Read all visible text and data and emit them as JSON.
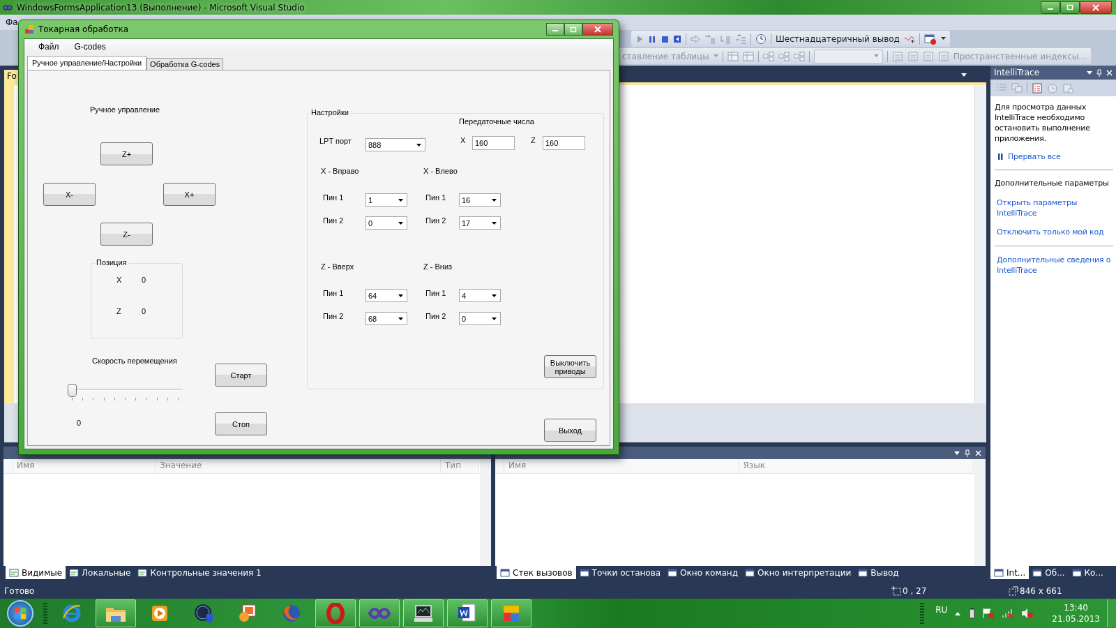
{
  "vs": {
    "title": "WindowsFormsApplication13 (Выполнение) - Microsoft Visual Studio",
    "menu": [
      "Фа"
    ],
    "toolbar1": {
      "label": "Шестнадцатеричный вывод"
    },
    "toolbar2": {
      "menu_label": "ставление таблицы",
      "label": "Пространственные индексы..."
    },
    "doc_tab": "Fo",
    "intellitrace": {
      "title": "IntelliTrace",
      "message": "Для просмотра данных IntelliTrace необходимо остановить выполнение приложения.",
      "break_link": "Прервать все",
      "section": "Дополнительные параметры",
      "links": [
        "Открыть параметры IntelliTrace",
        "Отключить только мой код"
      ],
      "more_link": "Дополнительные сведения о IntelliTrace"
    },
    "left_panel": {
      "columns": [
        "Имя",
        "Значение",
        "Тип"
      ]
    },
    "right_panel": {
      "columns": [
        "Имя",
        "Язык"
      ]
    },
    "left_tabs": [
      {
        "label": "Видимые",
        "selected": true
      },
      {
        "label": "Локальные",
        "selected": false
      },
      {
        "label": "Контрольные значения 1",
        "selected": false
      }
    ],
    "right_tabs": [
      {
        "label": "Стек вызовов",
        "selected": true
      },
      {
        "label": "Точки останова",
        "selected": false
      },
      {
        "label": "Окно команд",
        "selected": false
      },
      {
        "label": "Окно интерпретации",
        "selected": false
      },
      {
        "label": "Вывод",
        "selected": false
      }
    ],
    "side_tabs": [
      {
        "label": "Int...",
        "selected": true
      },
      {
        "label": "Об...",
        "selected": false
      },
      {
        "label": "Ко...",
        "selected": false
      }
    ],
    "status": {
      "text": "Готово",
      "position": "0 , 27",
      "size": "846 x 661"
    }
  },
  "taskbar": {
    "apps": [
      {
        "kind": "ie",
        "open": false
      },
      {
        "kind": "folder",
        "open": true
      },
      {
        "kind": "media",
        "open": false
      },
      {
        "kind": "shield",
        "open": false
      },
      {
        "kind": "photos",
        "open": false
      },
      {
        "kind": "firefox",
        "open": false
      },
      {
        "kind": "opera",
        "open": true
      },
      {
        "kind": "vs",
        "open": true
      },
      {
        "kind": "monitor",
        "open": true
      },
      {
        "kind": "word",
        "open": true
      },
      {
        "kind": "app",
        "open": true
      }
    ],
    "lang": "RU",
    "time": "13:40",
    "date": "21.05.2013"
  },
  "dialog": {
    "title": "Токарная обработка",
    "menu": [
      "Файл",
      "G-codes"
    ],
    "tabs": [
      {
        "label": "Ручное управление/Настройки",
        "selected": true
      },
      {
        "label": "Обработка G-codes",
        "selected": false
      }
    ],
    "manual": {
      "title": "Ручное управление",
      "buttons": [
        "Z+",
        "X-",
        "X+",
        "Z-"
      ]
    },
    "position": {
      "title": "Позиция",
      "rows": [
        {
          "axis": "X",
          "value": "0"
        },
        {
          "axis": "Z",
          "value": "0"
        }
      ]
    },
    "speed": {
      "title": "Скорость перемещения",
      "level": 0,
      "reading": "0"
    },
    "start": "Старт",
    "stop": "Стоп",
    "settings": {
      "title": "Настройки",
      "lpt_label": "LPT порт",
      "lpt_value": "888",
      "ratios_title": "Передаточные числа",
      "ratios": [
        {
          "axis": "X",
          "value": "160"
        },
        {
          "axis": "Z",
          "value": "160"
        }
      ],
      "groups": [
        {
          "title": "X - Вправо",
          "pins": [
            {
              "label": "Пин 1",
              "value": "1"
            },
            {
              "label": "Пин 2",
              "value": "0"
            }
          ]
        },
        {
          "title": "X - Влево",
          "pins": [
            {
              "label": "Пин 1",
              "value": "16"
            },
            {
              "label": "Пин 2",
              "value": "17"
            }
          ]
        },
        {
          "title": "Z - Вверх",
          "pins": [
            {
              "label": "Пин 1",
              "value": "64"
            },
            {
              "label": "Пин 2",
              "value": "68"
            }
          ]
        },
        {
          "title": "Z - Вниз",
          "pins": [
            {
              "label": "Пин 1",
              "value": "4"
            },
            {
              "label": "Пин 2",
              "value": "0"
            }
          ]
        }
      ],
      "drives_button": "Выключить приводы"
    },
    "exit": "Выход"
  }
}
